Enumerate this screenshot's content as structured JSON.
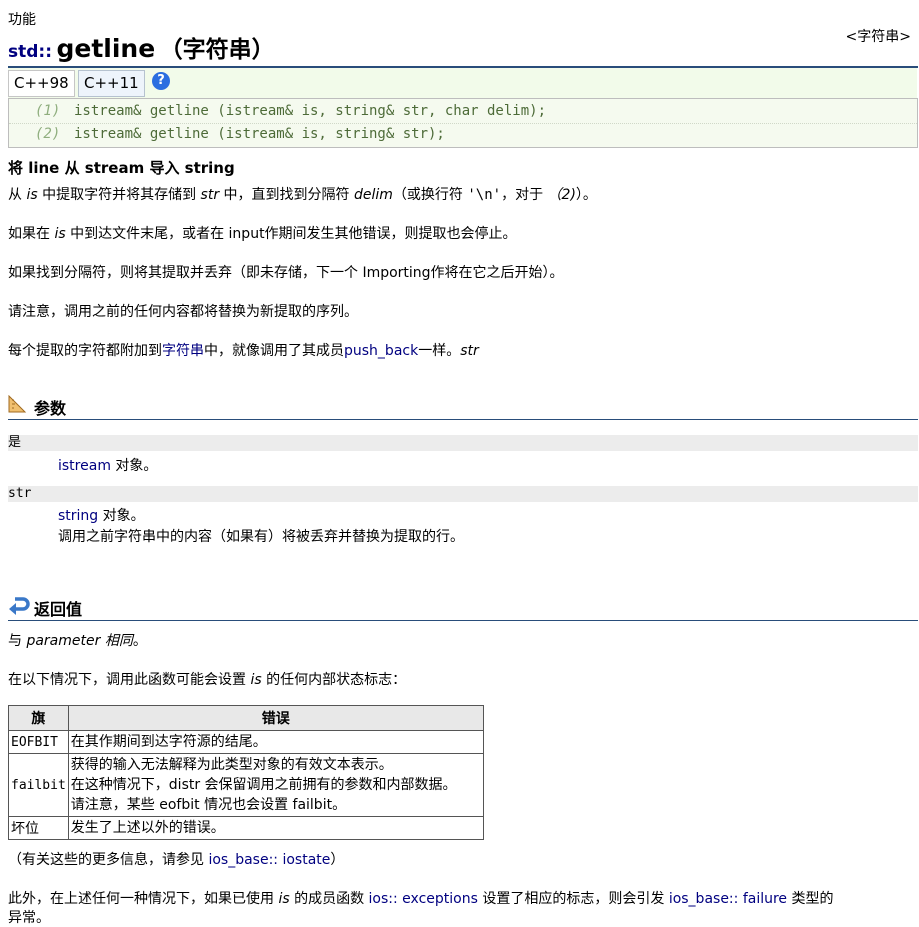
{
  "crumb": "功能",
  "type_label": "<字符串>",
  "title": {
    "ns": "std::",
    "name": "getline",
    "sub": "（字符串）"
  },
  "tabs": [
    "C++98",
    "C++11"
  ],
  "help_icon": "?",
  "declarations": [
    {
      "num": "(1)",
      "code": "istream& getline (istream& is, string& str, char delim);"
    },
    {
      "num": "(2)",
      "code": "istream& getline (istream& is, string& str);"
    }
  ],
  "summary": "将 line 从 stream 导入 string",
  "desc": {
    "p1": {
      "a": "从 ",
      "is": "is",
      "b": " 中提取字符并将其存储到 ",
      "str": "str",
      "c": " 中，直到找到分隔符 ",
      "delim": "delim",
      "d": "（或换行符 ",
      "nl": "'\\n'",
      "e": "，对于 ",
      "f": "（2)",
      "g": "）。"
    },
    "p2": {
      "a": "如果在 ",
      "is": "is",
      "b": " 中到达文件末尾，或者在 input作期间发生其他错误，则提取也会停止。"
    },
    "p3": "如果找到分隔符，则将其提取并丢弃（即未存储，下一个 Importing作将在它之后开始）。",
    "p4": "请注意，调用之前的任何内容都将替换为新提取的序列。",
    "p5": {
      "a": "每个提取的字符都附加到",
      "link1": "字符串",
      "b": "中，就像调用了其成员",
      "link2": "push_back",
      "c": "一样。",
      "str": "str"
    }
  },
  "params_heading": "参数",
  "params": [
    {
      "name": "是",
      "lines": [
        {
          "link": "istream",
          "text": " 对象。"
        }
      ]
    },
    {
      "name": "str",
      "lines": [
        {
          "link": "string",
          "text": " 对象。"
        },
        {
          "link": "",
          "text": "调用之前字符串中的内容（如果有）将被丢弃并替换为提取的行。"
        }
      ]
    }
  ],
  "return_heading": "返回值",
  "return": {
    "p1": {
      "a": "与 ",
      "b": "parameter 相同",
      "c": "。"
    },
    "p2": {
      "a": "在以下情况下，调用此函数可能会设置 ",
      "is": "is",
      "b": " 的任何内部状态标志："
    }
  },
  "table": {
    "headers": [
      "旗",
      "错误"
    ],
    "rows": [
      {
        "flag": "EOFBIT",
        "lines": [
          "在其作期间到达字符源的结尾。"
        ]
      },
      {
        "flag": "failbit",
        "lines": [
          "获得的输入无法解释为此类型对象的有效文本表示。",
          "在这种情况下，distr 会保留调用之前拥有的参数和内部数据。",
          "请注意，某些 eofbit 情况也会设置 failbit。"
        ]
      },
      {
        "flag": "坏位",
        "lines": [
          "发生了上述以外的错误。"
        ]
      }
    ]
  },
  "after_table": {
    "a": "（有关这些的更多信息，请参见 ",
    "link": "ios_base:: iostate",
    "b": "）"
  },
  "final": {
    "a": "此外，在上述任何一种情况下，如果已使用 ",
    "is": "is",
    "b": " 的成员函数 ",
    "link1": "ios:: exceptions",
    "c": " 设置了相应的标志，则会引发 ",
    "link2": "ios_base:: failure",
    "d": " 类型的",
    "e": "异常。"
  },
  "colors": {
    "link": "#000080",
    "rule": "#294d7a",
    "code": "#4d6b38",
    "band": "#ececec"
  }
}
